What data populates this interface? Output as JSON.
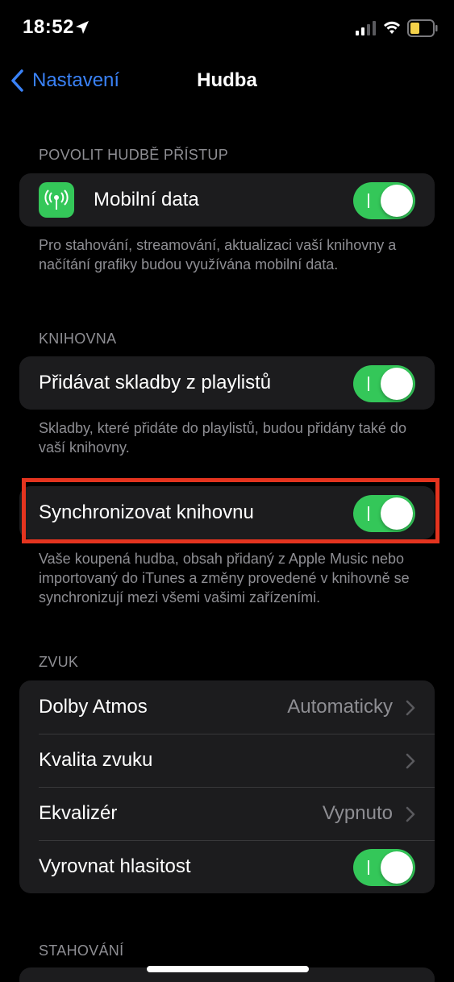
{
  "status": {
    "time": "18:52"
  },
  "nav": {
    "back_label": "Nastavení",
    "title": "Hudba"
  },
  "sections": {
    "access": {
      "header": "POVOLIT HUDBĚ PŘÍSTUP",
      "row_label": "Mobilní data",
      "toggle_on": true,
      "footer": "Pro stahování, streamování, aktualizaci vaší knihovny a načítání grafiky budou využívána mobilní data."
    },
    "library": {
      "header": "KNIHOVNA",
      "add_songs_label": "Přidávat skladby z playlistů",
      "add_songs_on": true,
      "add_songs_footer": "Skladby, které přidáte do playlistů, budou přidány také do vaší knihovny.",
      "sync_label": "Synchronizovat knihovnu",
      "sync_on": true,
      "sync_footer": "Vaše koupená hudba, obsah přidaný z Apple Music nebo importovaný do iTunes a změny provedené v knihovně se synchronizují mezi všemi vašimi zařízeními."
    },
    "sound": {
      "header": "ZVUK",
      "dolby_label": "Dolby Atmos",
      "dolby_value": "Automaticky",
      "quality_label": "Kvalita zvuku",
      "eq_label": "Ekvalizér",
      "eq_value": "Vypnuto",
      "volume_label": "Vyrovnat hlasitost",
      "volume_on": true
    },
    "downloads": {
      "header": "STAHOVÁNÍ"
    }
  },
  "colors": {
    "accent": "#3a82f7",
    "toggle_on": "#34c759",
    "highlight": "#e4341f",
    "battery": "#f4d14a"
  }
}
